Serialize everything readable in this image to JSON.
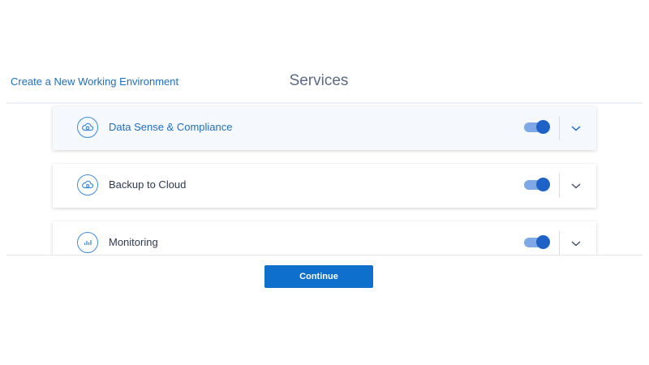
{
  "header": {
    "breadcrumb": "Create a New Working Environment",
    "title": "Services"
  },
  "services": [
    {
      "label": "Data Sense & Compliance",
      "icon": "cloud-shield-icon",
      "enabled": true,
      "active": true
    },
    {
      "label": "Backup to Cloud",
      "icon": "cloud-backup-icon",
      "enabled": true,
      "active": false
    },
    {
      "label": "Monitoring",
      "icon": "bar-chart-icon",
      "enabled": true,
      "active": false
    }
  ],
  "footer": {
    "continue_label": "Continue"
  },
  "colors": {
    "accent": "#1f6fbf",
    "button": "#0f6fcd",
    "toggle_track": "#7ea8e6",
    "toggle_knob": "#1f62c7"
  }
}
